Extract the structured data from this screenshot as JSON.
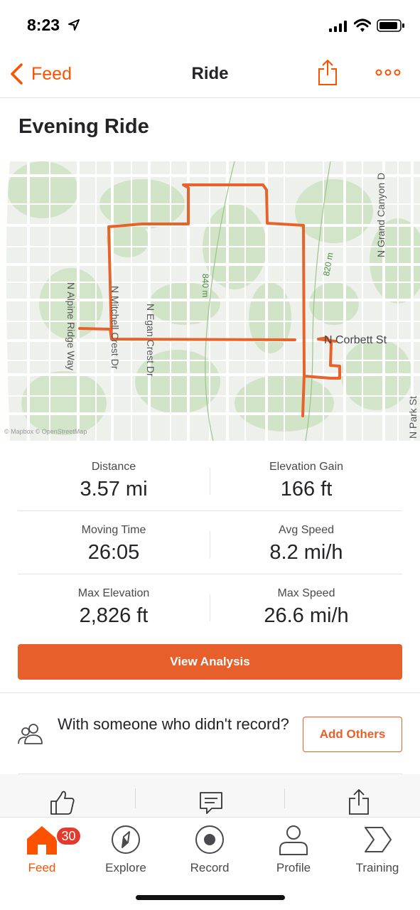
{
  "status": {
    "time": "8:23"
  },
  "nav": {
    "back_label": "Feed",
    "title": "Ride"
  },
  "activity": {
    "title": "Evening Ride"
  },
  "map": {
    "street_labels": [
      "N Alpine Ridge Way",
      "N Mitchell Crest Dr",
      "N Egan Crest Dr",
      "N Corbett St",
      "N Grand Canyon D",
      "N Park St"
    ],
    "contour_labels": [
      "840 m",
      "820 m"
    ],
    "attribution": "© Mapbox © OpenStreetMap",
    "route_color": "#e8632b"
  },
  "stats": [
    {
      "left": {
        "label": "Distance",
        "value": "3.57 mi"
      },
      "right": {
        "label": "Elevation Gain",
        "value": "166 ft"
      }
    },
    {
      "left": {
        "label": "Moving Time",
        "value": "26:05"
      },
      "right": {
        "label": "Avg Speed",
        "value": "8.2 mi/h"
      }
    },
    {
      "left": {
        "label": "Max Elevation",
        "value": "2,826 ft"
      },
      "right": {
        "label": "Max Speed",
        "value": "26.6 mi/h"
      }
    }
  ],
  "analysis_button": "View Analysis",
  "companions": {
    "text": "With someone who didn't record?",
    "button": "Add Others"
  },
  "actions": [
    "thumbs-up-icon",
    "comment-icon",
    "share-icon"
  ],
  "tabs": [
    {
      "label": "Feed",
      "badge": "30",
      "icon": "home-icon",
      "active": true
    },
    {
      "label": "Explore",
      "icon": "compass-icon"
    },
    {
      "label": "Record",
      "icon": "record-icon"
    },
    {
      "label": "Profile",
      "icon": "person-icon"
    },
    {
      "label": "Training",
      "icon": "chevron-icon"
    }
  ],
  "colors": {
    "accent": "#fc5200",
    "button": "#e75f2a",
    "badge": "#e23a2c"
  }
}
